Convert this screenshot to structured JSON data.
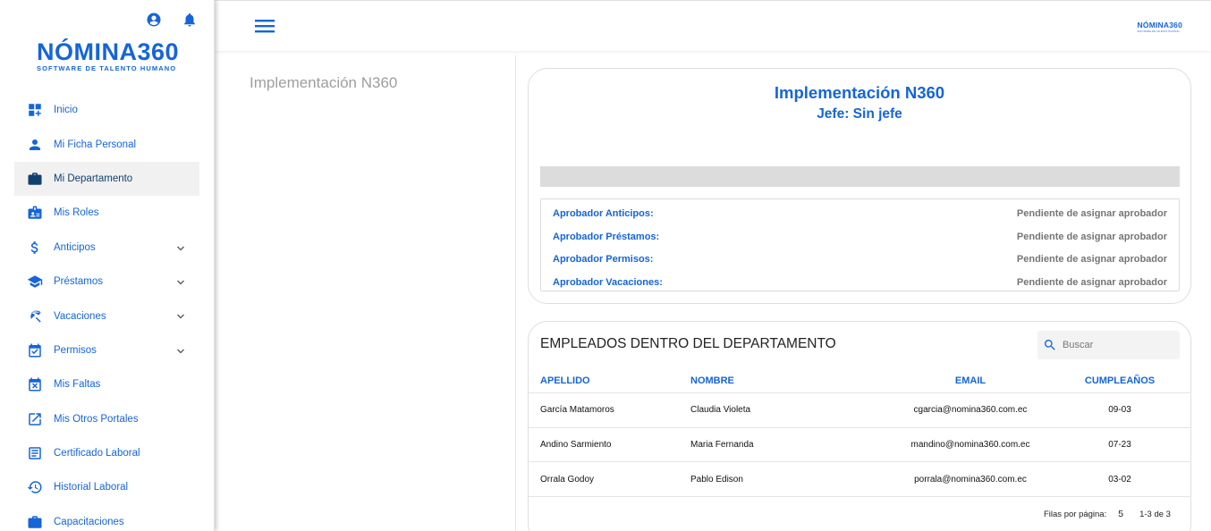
{
  "sidebar": {
    "logo": {
      "brand": "NÓMINA360",
      "tagline": "SOFTWARE DE TALENTO HUMANO"
    },
    "top_icons": [
      "account-circle-icon",
      "bell-icon"
    ],
    "items": [
      {
        "label": "Inicio",
        "icon": "dashboard-add-icon",
        "expandable": false,
        "active": false
      },
      {
        "label": "Mi Ficha Personal",
        "icon": "person-icon",
        "expandable": false,
        "active": false
      },
      {
        "label": "Mi Departamento",
        "icon": "briefcase-icon",
        "expandable": false,
        "active": true
      },
      {
        "label": "Mis Roles",
        "icon": "id-badge-icon",
        "expandable": false,
        "active": false
      },
      {
        "label": "Anticipos",
        "icon": "dollar-icon",
        "expandable": true,
        "active": false
      },
      {
        "label": "Préstamos",
        "icon": "school-icon",
        "expandable": true,
        "active": false
      },
      {
        "label": "Vacaciones",
        "icon": "beach-umbrella-icon",
        "expandable": true,
        "active": false
      },
      {
        "label": "Permisos",
        "icon": "calendar-check-icon",
        "expandable": true,
        "active": false
      },
      {
        "label": "Mis Faltas",
        "icon": "calendar-x-icon",
        "expandable": false,
        "active": false
      },
      {
        "label": "Mis Otros Portales",
        "icon": "open-external-icon",
        "expandable": false,
        "active": false
      },
      {
        "label": "Certificado Laboral",
        "icon": "document-icon",
        "expandable": false,
        "active": false
      },
      {
        "label": "Historial Laboral",
        "icon": "history-icon",
        "expandable": false,
        "active": false
      },
      {
        "label": "Capacitaciones",
        "icon": "training-icon",
        "expandable": false,
        "active": false
      }
    ]
  },
  "topbar": {
    "mini_logo": "NÓMINA360",
    "mini_tagline": "SOFTWARE DE TALENTO HUMANO"
  },
  "departments": {
    "selected": "Implementación N360"
  },
  "dept_card": {
    "title": "Implementación N360",
    "boss": "Jefe: Sin jefe",
    "approvers": [
      {
        "label": "Aprobador Anticipos:",
        "value": "Pendiente de asignar aprobador"
      },
      {
        "label": "Aprobador Préstamos:",
        "value": "Pendiente de asignar aprobador"
      },
      {
        "label": "Aprobador Permisos:",
        "value": "Pendiente de asignar aprobador"
      },
      {
        "label": "Aprobador Vacaciones:",
        "value": "Pendiente de asignar aprobador"
      }
    ]
  },
  "employees": {
    "title": "EMPLEADOS DENTRO DEL DEPARTAMENTO",
    "search_placeholder": "Buscar",
    "columns": [
      "APELLIDO",
      "NOMBRE",
      "EMAIL",
      "CUMPLEAÑOS"
    ],
    "rows": [
      [
        "García Matamoros",
        "Claudia Violeta",
        "cgarcia@nomina360.com.ec",
        "09-03"
      ],
      [
        "Andino Sarmiento",
        "Maria Fernanda",
        "mandino@nomina360.com.ec",
        "07-23"
      ],
      [
        "Orrala Godoy",
        "Pablo Edison",
        "porrala@nomina360.com.ec",
        "03-02"
      ]
    ],
    "rows_per_page_label": "Filas por página:",
    "rows_per_page": "5",
    "range": "1-3 de 3"
  },
  "colors": {
    "primary": "#1565d8",
    "active_text": "#12406e",
    "muted": "#9e9e9e"
  }
}
